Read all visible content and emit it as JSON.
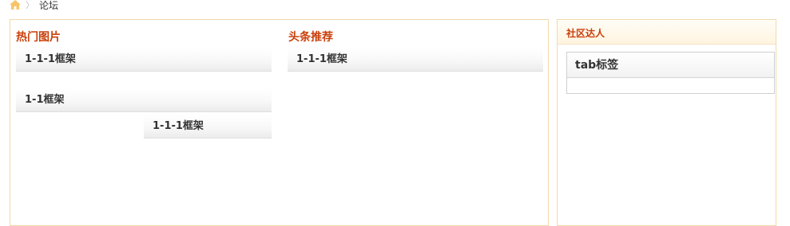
{
  "breadcrumb": {
    "home_icon": "home-icon",
    "separator": "〉",
    "current": "论坛"
  },
  "main": {
    "hot_images": {
      "title": "热门图片",
      "frames": [
        "1-1-1框架",
        "1-1框架",
        "1-1-1框架"
      ]
    },
    "headline": {
      "title": "头条推荐",
      "frames": [
        "1-1-1框架"
      ]
    }
  },
  "sidebar": {
    "title": "社区达人",
    "tab_label": "tab标签"
  },
  "colors": {
    "accent": "#c9400b",
    "panel_border": "#f3d9a8",
    "home_icon": "#f5c56a"
  }
}
